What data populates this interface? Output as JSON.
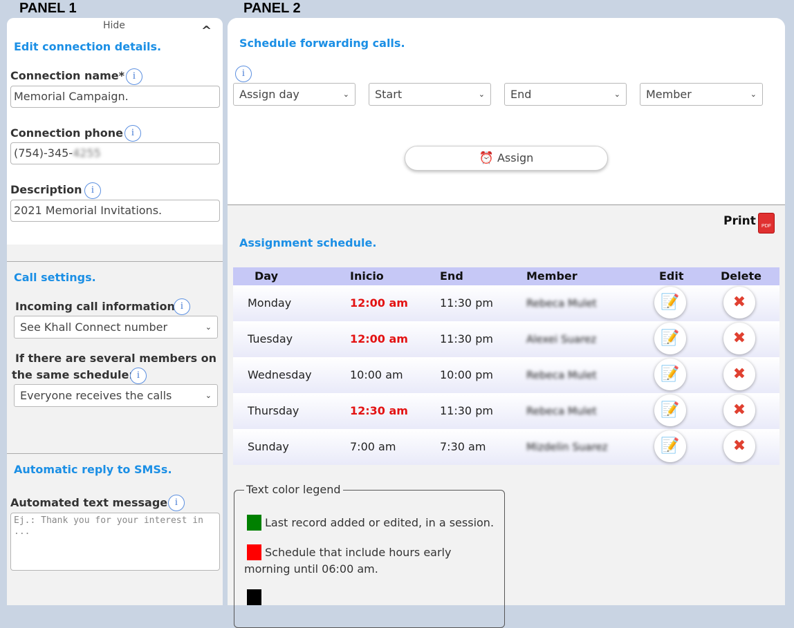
{
  "panels": {
    "p1": "PANEL 1",
    "p2": "PANEL 2"
  },
  "left": {
    "hide": "Hide",
    "hide_icon": "^",
    "section1": "Edit connection details.",
    "conn_name_label": "Connection name*",
    "conn_name_value": "Memorial Campaign.",
    "conn_phone_label": "Connection phone",
    "conn_phone_value": "(754)-345-",
    "conn_phone_hidden": "4255",
    "desc_label": "Description",
    "desc_value": "2021 Memorial Invitations.",
    "section2": "Call settings.",
    "incoming_label": "Incoming call information",
    "incoming_value": "See Khall Connect number",
    "several_label_1": "If there are several members on",
    "several_label_2": "the same schedule:",
    "several_value": "Everyone receives the calls",
    "section3": "Automatic reply to SMSs.",
    "auto_label": "Automated text message",
    "auto_placeholder": "Ej.: Thank you for your interest in ..."
  },
  "right": {
    "title": "Schedule forwarding calls.",
    "selects": [
      "Assign day",
      "Start",
      "End",
      "Member"
    ],
    "assign_btn": "Assign",
    "print": "Print",
    "pdf": "PDF",
    "schedule_title": "Assignment schedule.",
    "headers": [
      "Day",
      "Inicio",
      "End",
      "Member",
      "Edit",
      "Delete"
    ],
    "rows": [
      {
        "day": "Monday",
        "start": "12:00 am",
        "end": "11:30 pm",
        "member": "Rebeca Mulet",
        "early": true
      },
      {
        "day": "Tuesday",
        "start": "12:00 am",
        "end": "11:30 pm",
        "member": "Alexei Suarez",
        "early": true
      },
      {
        "day": "Wednesday",
        "start": "10:00 am",
        "end": "10:00 pm",
        "member": "Rebeca Mulet",
        "early": false
      },
      {
        "day": "Thursday",
        "start": "12:30 am",
        "end": "11:30 pm",
        "member": "Rebeca Mulet",
        "early": true
      },
      {
        "day": "Sunday",
        "start": "7:00 am",
        "end": "7:30 am",
        "member": "Mizdelin Suarez",
        "early": false
      }
    ],
    "legend_title": "Text color legend",
    "legend_1": "Last record added or edited, in a session.",
    "legend_2a": "Schedule that include hours early",
    "legend_2b": "morning until 06:00 am."
  },
  "colors": {
    "accent": "#1b8fe5",
    "early": "#e31212",
    "edited": "#008000",
    "header": "#c6c8f6"
  },
  "icons": {
    "info": "i",
    "edit": "📝",
    "delete": "✖",
    "alarm": "⏰",
    "chevron": "⌄"
  }
}
